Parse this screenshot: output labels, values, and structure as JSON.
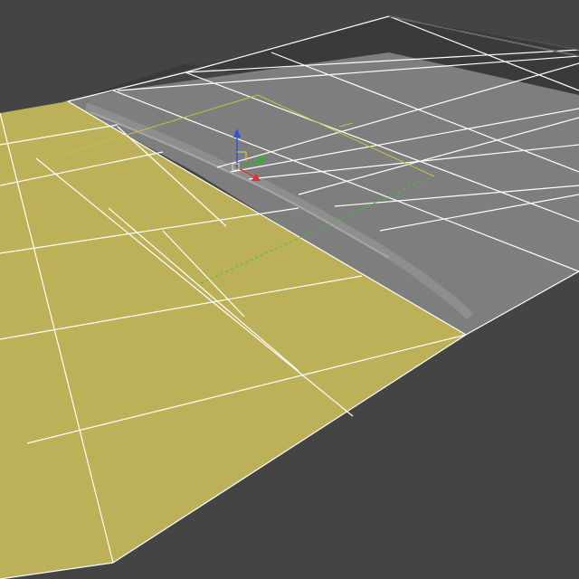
{
  "viewport": {
    "view": "perspective-3d",
    "background_color": "#444444",
    "ground_grid_color": "#565656"
  },
  "scene": {
    "selected_plane": {
      "name": "",
      "fill_color": "#BCB058",
      "wire_color": "#FFFFFF",
      "selected": true
    },
    "road_surface": {
      "name": "",
      "fill_color": "#7E7E7E",
      "wire_color": "#FFFFFF",
      "texture": "asphalt-road-strip"
    },
    "gizmo": {
      "type": "move-transform-gizmo",
      "axes": [
        {
          "name": "x",
          "color": "#E03030"
        },
        {
          "name": "y",
          "color": "#30B030"
        },
        {
          "name": "z",
          "color": "#3050E0"
        }
      ]
    },
    "bounding_box_color": "#C8C040",
    "pivot_line_color": "#33CC33"
  }
}
